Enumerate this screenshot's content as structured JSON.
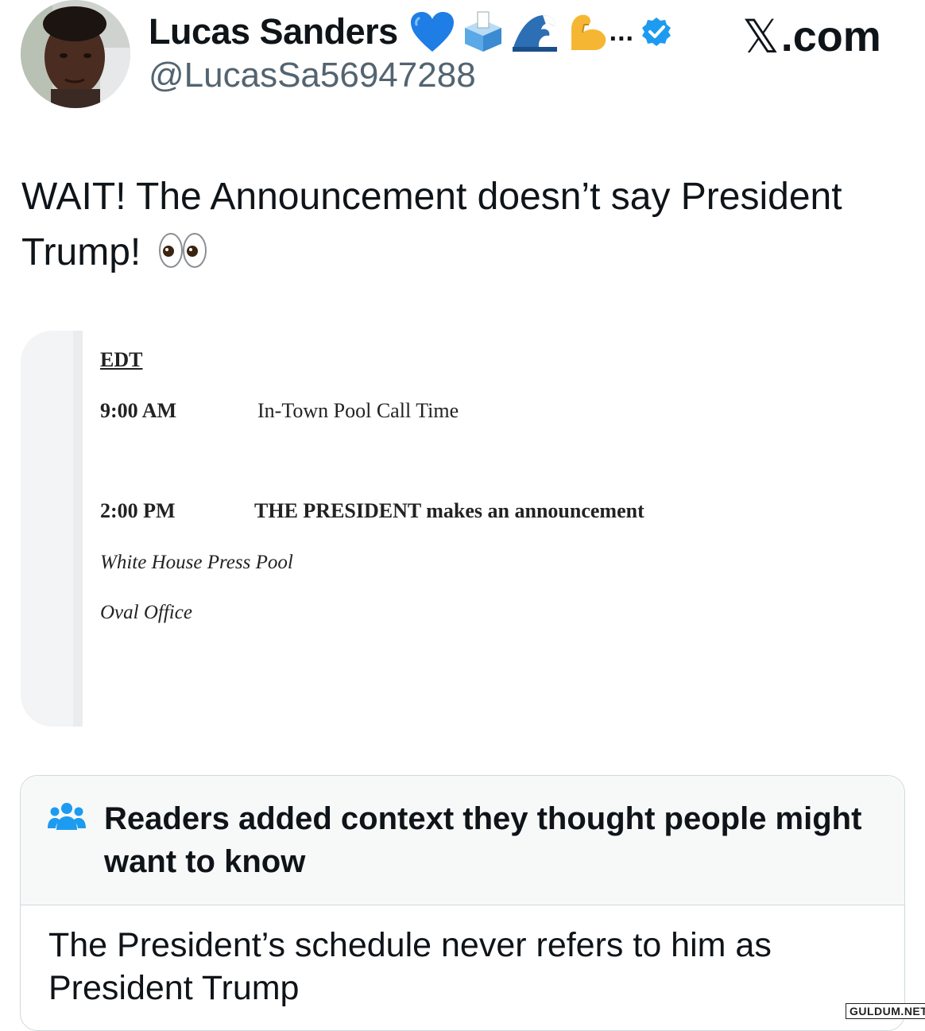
{
  "author": {
    "display_name": "Lucas Sanders",
    "handle": "@LucasSa56947288",
    "badges": [
      "blue-heart-icon",
      "ballot-box-icon",
      "wave-icon",
      "flexed-biceps-icon"
    ],
    "ellipsis": "...",
    "verified": true
  },
  "brand": {
    "x_mark": "𝕏",
    "suffix": ".com"
  },
  "tweet": {
    "text": "WAIT! The Announcement doesn’t say President Trump!",
    "emoji": "eyes-icon"
  },
  "schedule": {
    "timezone": "EDT",
    "items": [
      {
        "time": "9:00 AM",
        "event": "In-Town Pool Call Time"
      },
      {
        "time": "2:00 PM",
        "event": "THE PRESIDENT makes an announcement"
      }
    ],
    "coverage": "White House Press Pool",
    "location": "Oval Office"
  },
  "community_note": {
    "title": "Readers added context they thought people might want to know",
    "body": "The President’s schedule never refers to him as President Trump",
    "icon": "people-icon"
  },
  "watermark": "GULDUM.NET",
  "colors": {
    "text": "#0f1419",
    "secondary": "#536471",
    "verified_blue": "#1d9bf0",
    "note_border": "#cfd9de",
    "note_header_bg": "#f7f9f9"
  }
}
